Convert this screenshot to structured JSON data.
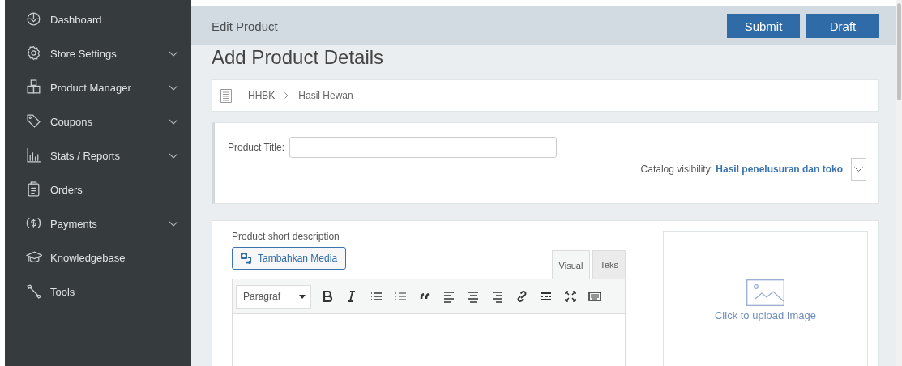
{
  "sidebar": {
    "items": [
      {
        "label": "Dashboard",
        "has_submenu": false
      },
      {
        "label": "Store Settings",
        "has_submenu": true
      },
      {
        "label": "Product Manager",
        "has_submenu": true
      },
      {
        "label": "Coupons",
        "has_submenu": true
      },
      {
        "label": "Stats / Reports",
        "has_submenu": true
      },
      {
        "label": "Orders",
        "has_submenu": false
      },
      {
        "label": "Payments",
        "has_submenu": true
      },
      {
        "label": "Knowledgebase",
        "has_submenu": false
      },
      {
        "label": "Tools",
        "has_submenu": false
      }
    ]
  },
  "header": {
    "title": "Edit Product",
    "buttons": [
      "Submit",
      "Draft"
    ]
  },
  "page_title": "Add Product Details",
  "breadcrumb": [
    "HHBK",
    "Hasil Hewan"
  ],
  "product_title": {
    "label": "Product Title:"
  },
  "catalog_visibility": {
    "label": "Catalog visibility:",
    "value": "Hasil penelusuran dan toko"
  },
  "short_description": {
    "label": "Product short description",
    "media_button": "Tambahkan Media",
    "tabs": [
      {
        "label": "Visual",
        "selected": true
      },
      {
        "label": "Teks",
        "selected": false
      }
    ],
    "format": "Paragraf"
  },
  "image_upload": {
    "text": "Click to upload Image"
  }
}
